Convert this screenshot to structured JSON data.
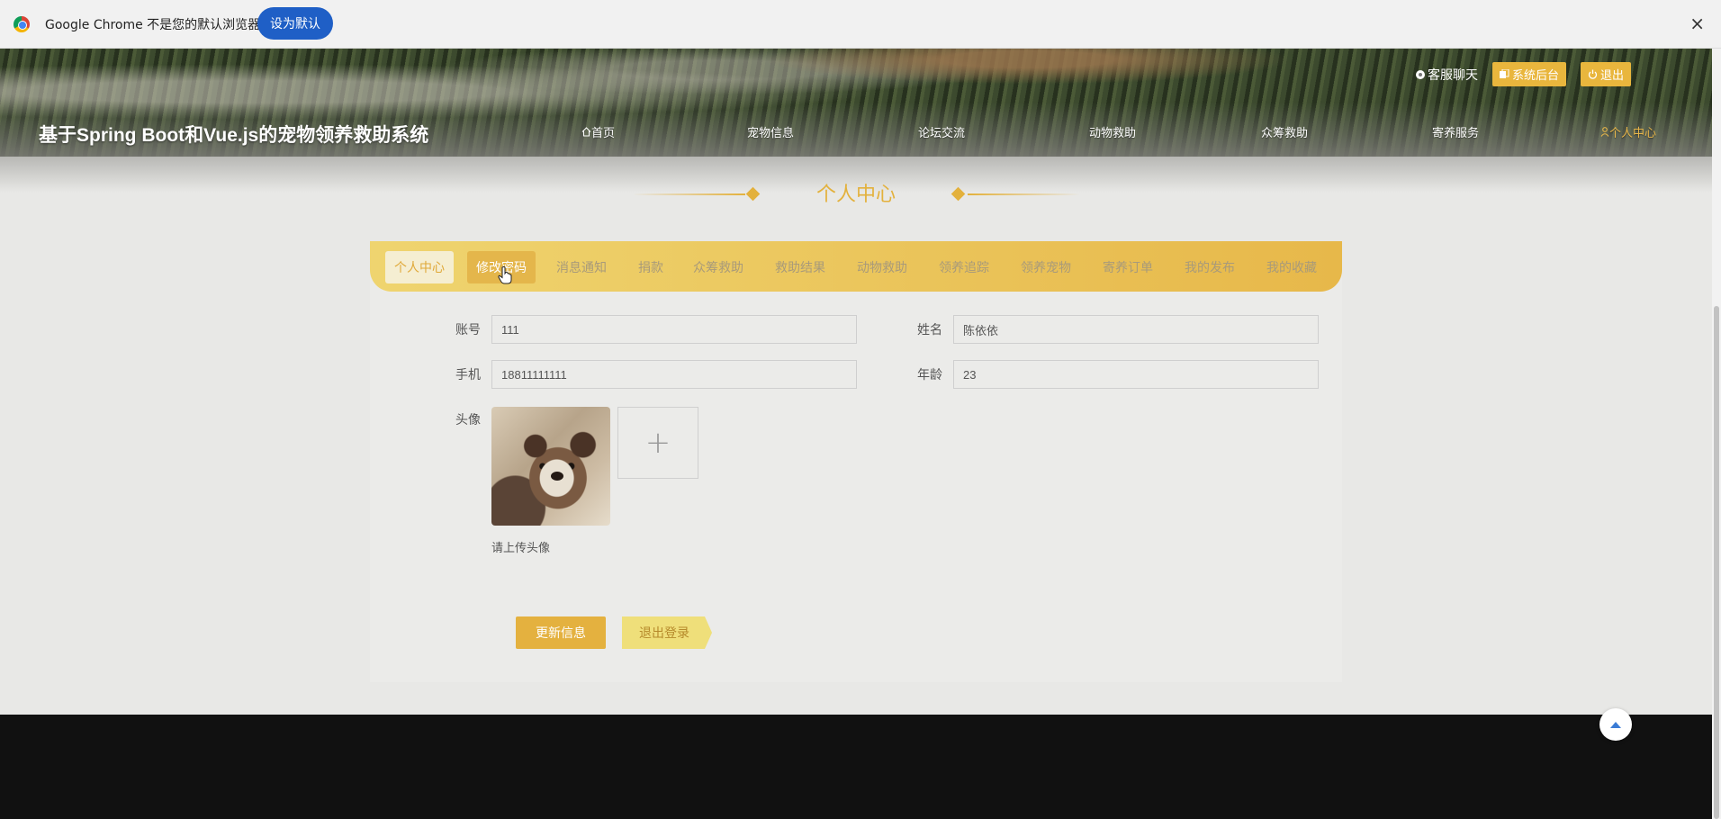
{
  "chrome": {
    "message": "Google Chrome 不是您的默认浏览器",
    "set_default": "设为默认",
    "close": "×"
  },
  "header": {
    "site_title": "基于Spring Boot和Vue.js的宠物领养救助系统",
    "top_links": {
      "chat": "客服聊天",
      "admin": "系统后台",
      "logout": "退出"
    },
    "nav": [
      "首页",
      "宠物信息",
      "论坛交流",
      "动物救助",
      "众筹救助",
      "寄养服务",
      "个人中心"
    ]
  },
  "section": {
    "title": "个人中心"
  },
  "tabs": [
    "个人中心",
    "修改密码",
    "消息通知",
    "捐款",
    "众筹救助",
    "救助结果",
    "动物救助",
    "领养追踪",
    "领养宠物",
    "寄养订单",
    "我的发布",
    "我的收藏"
  ],
  "form": {
    "account_label": "账号",
    "account_value": "111",
    "name_label": "姓名",
    "name_value": "陈依依",
    "phone_label": "手机",
    "phone_value": "18811111111",
    "age_label": "年龄",
    "age_value": "23",
    "avatar_label": "头像",
    "upload_icon": "+",
    "upload_hint": "请上传头像",
    "update_button": "更新信息",
    "logout_button": "退出登录"
  },
  "colors": {
    "accent": "#e4b13f",
    "tab_gradient_start": "#efd46f",
    "tab_gradient_end": "#e7b84a",
    "footer": "#111111"
  },
  "icons": {
    "chat": "chat-bubble-icon",
    "admin": "copy-icon",
    "logout": "power-icon",
    "home": "home-icon",
    "user": "user-icon",
    "back_to_top": "arrow-up-icon"
  }
}
